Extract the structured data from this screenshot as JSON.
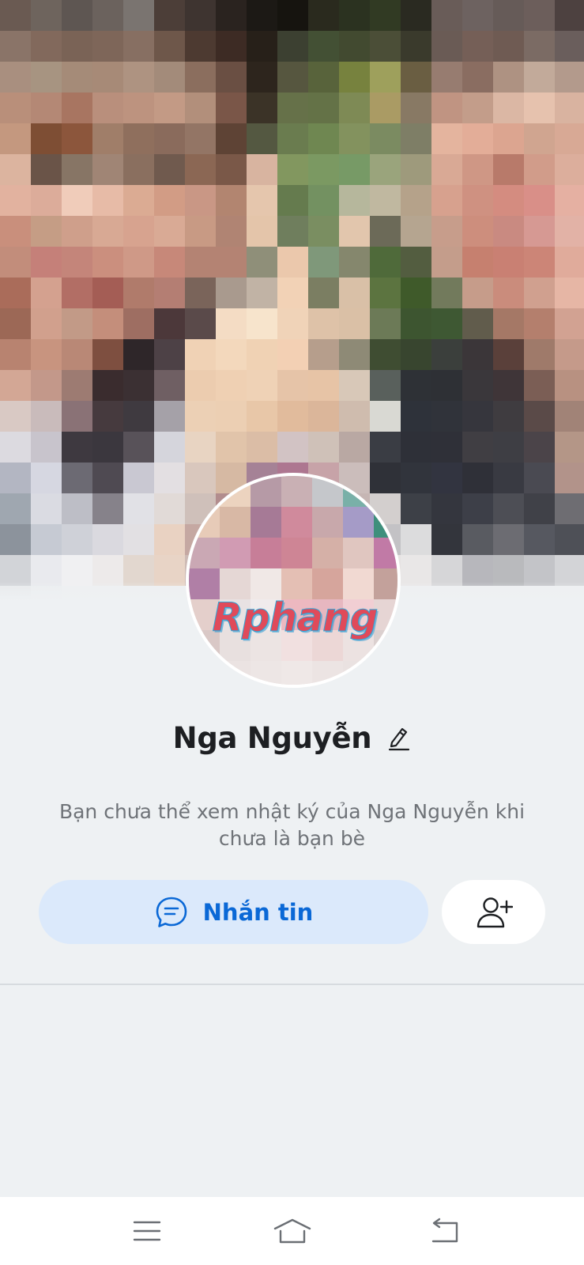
{
  "profile": {
    "name": "Nga Nguyễn",
    "info_text": "Bạn chưa thể xem nhật ký của Nga Nguyễn khi chưa là bạn bè",
    "avatar_watermark": "Rphang"
  },
  "actions": {
    "message_label": "Nhắn tin",
    "message_icon": "chat-bubble-icon",
    "add_friend_icon": "add-user-icon",
    "edit_icon": "pencil-icon"
  },
  "navbar": {
    "menu_icon": "menu-icon",
    "home_icon": "home-icon",
    "back_icon": "back-icon"
  },
  "colors": {
    "background": "#eef1f3",
    "message_button_bg": "#dbe9fb",
    "accent": "#0a68d6",
    "name_text": "#1d1f22",
    "info_text": "#6f7378"
  }
}
